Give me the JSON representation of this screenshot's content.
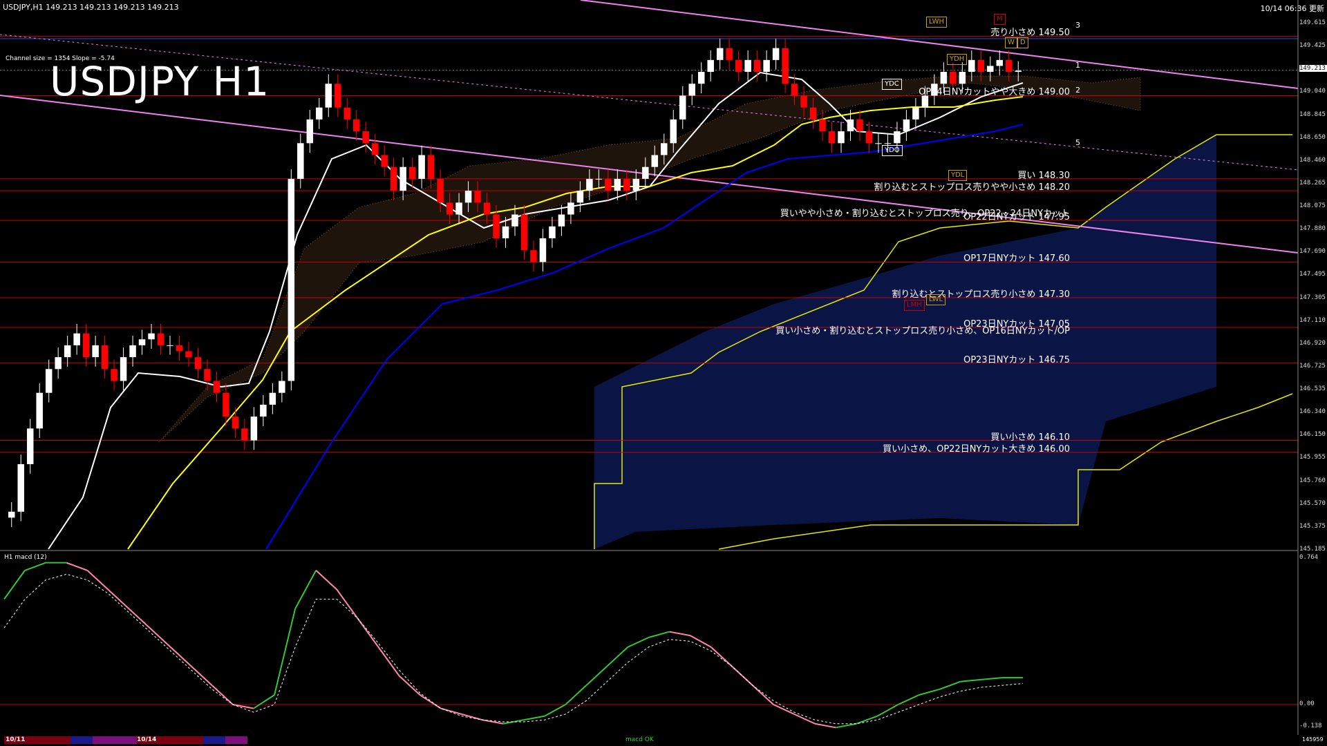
{
  "header": {
    "symbol_info": "USDJPY,H1  149.213 149.213 149.213 149.213",
    "timestamp": "10/14 06:36 更新",
    "channel_info": "Channel size = 1354 Slope = -5.74"
  },
  "main_title": "USDJPY H1",
  "macd_label": "H1  macd (12)",
  "price_axis": [
    "149.615",
    "149.425",
    "149.213",
    "149.040",
    "148.845",
    "148.650",
    "148.460",
    "148.265",
    "148.075",
    "147.880",
    "147.690",
    "147.495",
    "147.305",
    "147.110",
    "146.920",
    "146.725",
    "146.535",
    "146.340",
    "146.150",
    "145.955",
    "145.760",
    "145.570",
    "145.375",
    "145.185"
  ],
  "current_price": "149.213",
  "macd_axis": [
    "0.764",
    "0.00",
    "-0.138"
  ],
  "annotations": [
    {
      "text": "売り小さめ 149.50",
      "price": 149.5
    },
    {
      "text": "OP14日NYカットやや大きめ 149.00",
      "price": 149.0
    },
    {
      "text": "買い 148.30",
      "price": 148.3
    },
    {
      "text": "割り込むとストップロス売りやや小さめ 148.20",
      "price": 148.2
    },
    {
      "text": "買いやや小さめ・割り込むとストップロス売り、OP22・24日NYカット",
      "price": 147.98
    },
    {
      "text": "OP22日NYカット 147.95",
      "price": 147.95
    },
    {
      "text": "OP17日NYカット 147.60",
      "price": 147.6
    },
    {
      "text": "割り込むとストップロス売り小さめ 147.30",
      "price": 147.3
    },
    {
      "text": "OP23日NYカット 147.05",
      "price": 147.05
    },
    {
      "text": "買い小さめ・割り込むとストップロス売り小さめ、OP16日NYカット/OP",
      "price": 146.99
    },
    {
      "text": "OP23日NYカット 146.75",
      "price": 146.75
    },
    {
      "text": "買い小さめ 146.10",
      "price": 146.1
    },
    {
      "text": "買い小さめ、OP22日NYカット大きめ 146.00",
      "price": 146.0
    }
  ],
  "tags": [
    {
      "text": "LWH",
      "color": "#c8a000"
    },
    {
      "text": "M",
      "color": "#d00000"
    },
    {
      "text": "YDH",
      "color": "#c8a000"
    },
    {
      "text": "W",
      "color": "#c8a000"
    },
    {
      "text": "D",
      "color": "#c8a000"
    },
    {
      "text": "YDC",
      "color": "#ffffff"
    },
    {
      "text": "YDO",
      "color": "#ffffff"
    },
    {
      "text": "YDL",
      "color": "#c8a000"
    },
    {
      "text": "LMH",
      "color": "#d00000"
    },
    {
      "text": "LWL",
      "color": "#c8a000"
    }
  ],
  "channel_numbers": [
    "3",
    "1",
    "2",
    "5"
  ],
  "date_labels": [
    "10/11",
    "10/14"
  ],
  "macd_footer": "macd OK",
  "bottom_right": "145959",
  "colors": {
    "background": "#000000",
    "up_candle": "#ffffff",
    "down_candle": "#ff0000",
    "ma_short": "#ffffff",
    "ma_mid": "#ffff00",
    "ma_long": "#0000ff",
    "channel": "#ee82ee",
    "hline": "#cc0000",
    "hline_blue": "#1e50ff",
    "cloud": "#f4a460",
    "cloud_blue": "#1e3cc8",
    "macd_main": "#32c832",
    "macd_signal": "#ffffff"
  },
  "chart_data": {
    "type": "candlestick",
    "title": "USDJPY H1",
    "ylim": [
      145.185,
      149.7
    ],
    "levels": [
      149.5,
      149.0,
      148.3,
      148.2,
      147.95,
      147.6,
      147.3,
      147.05,
      146.75,
      146.1,
      146.0
    ],
    "close": [
      145.5,
      145.9,
      146.2,
      146.5,
      146.7,
      146.8,
      146.9,
      147.0,
      146.8,
      146.9,
      146.7,
      146.6,
      146.8,
      146.9,
      146.95,
      147.0,
      146.9,
      146.9,
      146.85,
      146.8,
      146.7,
      146.6,
      146.5,
      146.3,
      146.2,
      146.1,
      146.3,
      146.4,
      146.5,
      146.6,
      148.3,
      148.6,
      148.8,
      148.9,
      149.1,
      148.9,
      148.8,
      148.7,
      148.6,
      148.5,
      148.4,
      148.2,
      148.4,
      148.3,
      148.5,
      148.3,
      148.1,
      148.0,
      148.1,
      148.2,
      148.1,
      148.0,
      147.8,
      147.9,
      148.0,
      147.7,
      147.6,
      147.8,
      147.9,
      148.0,
      148.1,
      148.2,
      148.3,
      148.3,
      148.2,
      148.3,
      148.2,
      148.3,
      148.4,
      148.5,
      148.6,
      148.8,
      149.0,
      149.1,
      149.2,
      149.3,
      149.4,
      149.3,
      149.2,
      149.3,
      149.2,
      149.3,
      149.4,
      149.1,
      149.0,
      148.9,
      148.8,
      148.7,
      148.6,
      148.7,
      148.8,
      148.7,
      148.6,
      148.6,
      148.6,
      148.7,
      148.8,
      148.9,
      149.0,
      149.1,
      149.2,
      149.1,
      149.2,
      149.3,
      149.2,
      149.25,
      149.3,
      149.2,
      149.21
    ],
    "macd": [
      0.55,
      0.7,
      0.74,
      0.74,
      0.7,
      0.6,
      0.5,
      0.4,
      0.3,
      0.2,
      0.1,
      0.0,
      -0.02,
      0.05,
      0.5,
      0.7,
      0.6,
      0.45,
      0.3,
      0.15,
      0.05,
      -0.02,
      -0.05,
      -0.08,
      -0.1,
      -0.08,
      -0.06,
      0.0,
      0.1,
      0.2,
      0.3,
      0.35,
      0.38,
      0.36,
      0.3,
      0.2,
      0.1,
      0.0,
      -0.05,
      -0.1,
      -0.12,
      -0.1,
      -0.06,
      0.0,
      0.05,
      0.08,
      0.12,
      0.13,
      0.14,
      0.14
    ],
    "signal": [
      0.4,
      0.55,
      0.65,
      0.68,
      0.65,
      0.58,
      0.48,
      0.38,
      0.28,
      0.18,
      0.08,
      0.0,
      -0.04,
      0.0,
      0.3,
      0.55,
      0.55,
      0.45,
      0.32,
      0.18,
      0.06,
      -0.02,
      -0.06,
      -0.08,
      -0.09,
      -0.09,
      -0.08,
      -0.05,
      0.02,
      0.12,
      0.22,
      0.3,
      0.34,
      0.33,
      0.28,
      0.2,
      0.1,
      0.02,
      -0.04,
      -0.08,
      -0.1,
      -0.1,
      -0.08,
      -0.04,
      0.0,
      0.04,
      0.07,
      0.09,
      0.1,
      0.11
    ]
  }
}
